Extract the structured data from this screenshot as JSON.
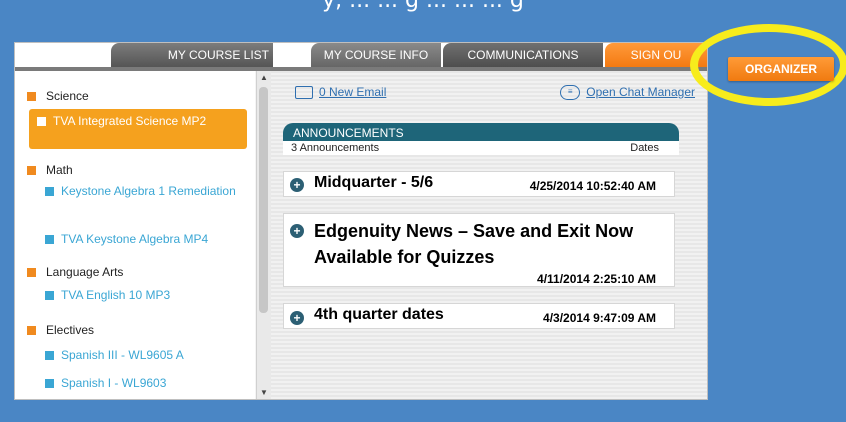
{
  "caption": "y, ... ... g ... ... ... g",
  "tabs": {
    "course_list": "MY COURSE LIST",
    "course_info": "MY COURSE INFO",
    "communications": "COMMUNICATIONS",
    "sign_out": "SIGN OU"
  },
  "organizer": "ORGANIZER",
  "sidebar": {
    "categories": [
      {
        "name": "Science",
        "courses": [
          "TVA Integrated Science MP2"
        ]
      },
      {
        "name": "Math",
        "courses": [
          "Keystone Algebra 1 Remediation",
          "TVA Keystone Algebra MP4"
        ]
      },
      {
        "name": "Language Arts",
        "courses": [
          "TVA English 10 MP3"
        ]
      },
      {
        "name": "Electives",
        "courses": [
          "Spanish III - WL9605 A",
          "Spanish I - WL9603"
        ]
      }
    ]
  },
  "main": {
    "email_link": "0 New Email",
    "chat_link": "Open Chat Manager",
    "announcements": {
      "title": "ANNOUNCEMENTS",
      "count": "3 Announcements",
      "dates_header": "Dates",
      "items": [
        {
          "title": "Midquarter - 5/6",
          "date": "4/25/2014 10:52:40 AM"
        },
        {
          "title": "Edgenuity News – Save and Exit Now Available for Quizzes",
          "date": "4/11/2014 2:25:10 AM"
        },
        {
          "title": "4th quarter dates",
          "date": "4/3/2014 9:47:09 AM"
        }
      ]
    }
  },
  "colors": {
    "background": "#4a86c5",
    "accent_orange": "#f5a11e",
    "link_blue": "#2f6fb0",
    "course_blue": "#3aa6d4",
    "header_teal": "#1e6579",
    "highlight_yellow": "#f7ec1c"
  }
}
